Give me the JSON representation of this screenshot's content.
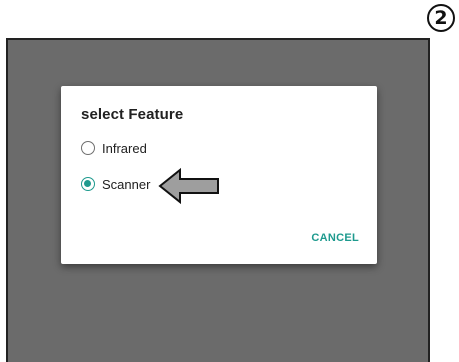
{
  "step_badge": "2",
  "dialog": {
    "title": "select Feature",
    "options": [
      {
        "label": "Infrared",
        "selected": false
      },
      {
        "label": "Scanner",
        "selected": true
      }
    ],
    "cancel_label": "CANCEL"
  },
  "colors": {
    "accent": "#1e9a8e",
    "screen_background": "#6b6b6b",
    "pointer_fill": "#9e9e9e"
  }
}
